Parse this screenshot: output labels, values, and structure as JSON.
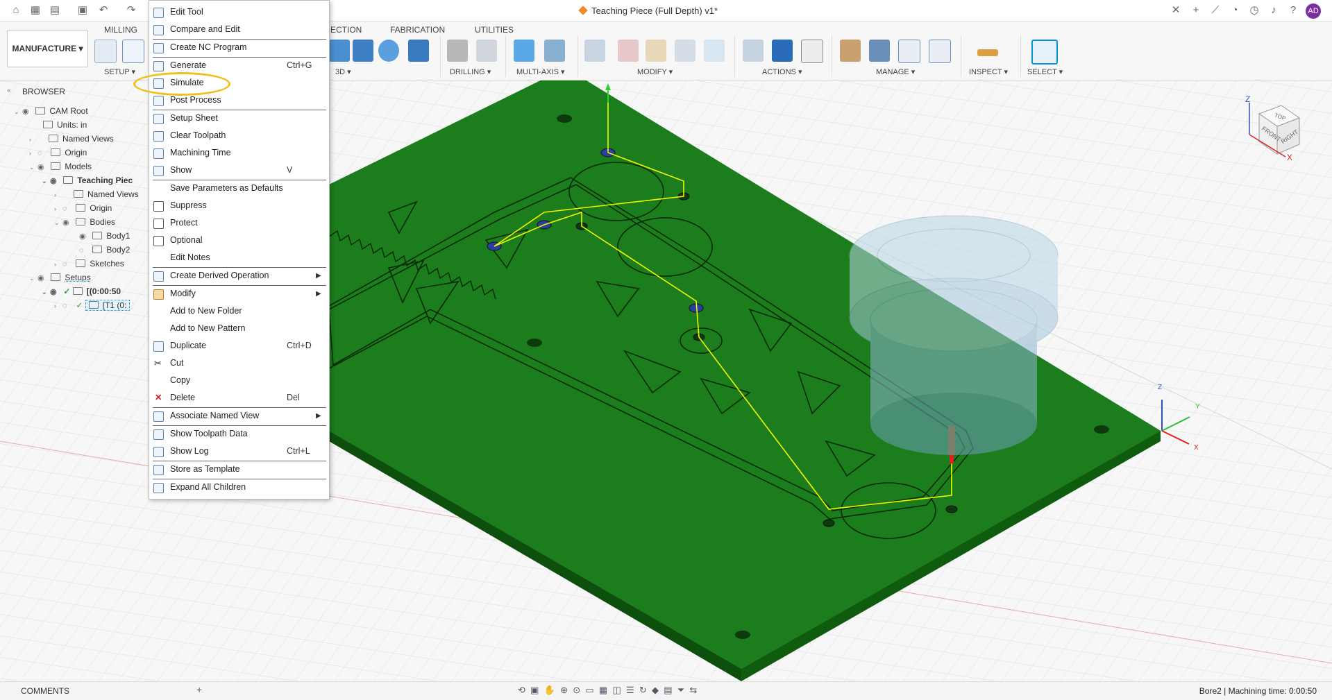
{
  "titlebar": {
    "document_title": "Teaching Piece (Full Depth) v1*",
    "avatar_initials": "AD"
  },
  "toolbar": {
    "workspace": "MANUFACTURE",
    "tabs": [
      "MILLING",
      "ECTION",
      "FABRICATION",
      "UTILITIES"
    ],
    "groups": [
      "SETUP",
      "3D",
      "DRILLING",
      "MULTI-AXIS",
      "MODIFY",
      "ACTIONS",
      "MANAGE",
      "INSPECT",
      "SELECT"
    ]
  },
  "browser": {
    "title": "BROWSER",
    "rows": [
      {
        "label": "CAM Root"
      },
      {
        "label": "Units: in"
      },
      {
        "label": "Named Views"
      },
      {
        "label": "Origin"
      },
      {
        "label": "Models"
      },
      {
        "label": "Teaching Piec"
      },
      {
        "label": "Named Views"
      },
      {
        "label": "Origin"
      },
      {
        "label": "Bodies"
      },
      {
        "label": "Body1"
      },
      {
        "label": "Body2"
      },
      {
        "label": "Sketches"
      },
      {
        "label": "Setups"
      },
      {
        "label": "[(0:00:50"
      },
      {
        "label": "[T1 (0:"
      }
    ]
  },
  "context_menu": {
    "items": [
      {
        "label": "Edit Tool",
        "shortcut": "",
        "submenu": false
      },
      {
        "label": "Compare and Edit",
        "shortcut": "",
        "submenu": false
      },
      {
        "label": "Create NC Program",
        "shortcut": "",
        "submenu": false
      },
      {
        "label": "Generate",
        "shortcut": "Ctrl+G",
        "submenu": false
      },
      {
        "label": "Simulate",
        "shortcut": "",
        "submenu": false
      },
      {
        "label": "Post Process",
        "shortcut": "",
        "submenu": false
      },
      {
        "label": "Setup Sheet",
        "shortcut": "",
        "submenu": false
      },
      {
        "label": "Clear Toolpath",
        "shortcut": "",
        "submenu": false
      },
      {
        "label": "Machining Time",
        "shortcut": "",
        "submenu": false
      },
      {
        "label": "Show",
        "shortcut": "V",
        "submenu": false
      },
      {
        "label": "Save Parameters as Defaults",
        "shortcut": "",
        "submenu": false
      },
      {
        "label": "Suppress",
        "shortcut": "",
        "submenu": false
      },
      {
        "label": "Protect",
        "shortcut": "",
        "submenu": false
      },
      {
        "label": "Optional",
        "shortcut": "",
        "submenu": false
      },
      {
        "label": "Edit Notes",
        "shortcut": "",
        "submenu": false
      },
      {
        "label": "Create Derived Operation",
        "shortcut": "",
        "submenu": true
      },
      {
        "label": "Modify",
        "shortcut": "",
        "submenu": true
      },
      {
        "label": "Add to New Folder",
        "shortcut": "",
        "submenu": false
      },
      {
        "label": "Add to New Pattern",
        "shortcut": "",
        "submenu": false
      },
      {
        "label": "Duplicate",
        "shortcut": "Ctrl+D",
        "submenu": false
      },
      {
        "label": "Cut",
        "shortcut": "",
        "submenu": false
      },
      {
        "label": "Copy",
        "shortcut": "",
        "submenu": false
      },
      {
        "label": "Delete",
        "shortcut": "Del",
        "submenu": false
      },
      {
        "label": "Associate Named View",
        "shortcut": "",
        "submenu": true
      },
      {
        "label": "Show Toolpath Data",
        "shortcut": "",
        "submenu": false
      },
      {
        "label": "Show Log",
        "shortcut": "Ctrl+L",
        "submenu": false
      },
      {
        "label": "Store as Template",
        "shortcut": "",
        "submenu": false
      },
      {
        "label": "Expand All Children",
        "shortcut": "",
        "submenu": false
      }
    ]
  },
  "viewcube": {
    "top": "TOP",
    "front": "FRONT",
    "right": "RIGHT",
    "axis_z": "Z",
    "axis_x": "X"
  },
  "triad": {
    "x": "X",
    "y": "Y",
    "z": "Z"
  },
  "bottombar": {
    "comments": "COMMENTS",
    "status": "Bore2 | Machining time: 0:00:50"
  },
  "colors": {
    "plate": "#1b7a1b",
    "toolpath": "#f5f500",
    "accent": "#0696d7",
    "highlight": "#f0c020"
  }
}
